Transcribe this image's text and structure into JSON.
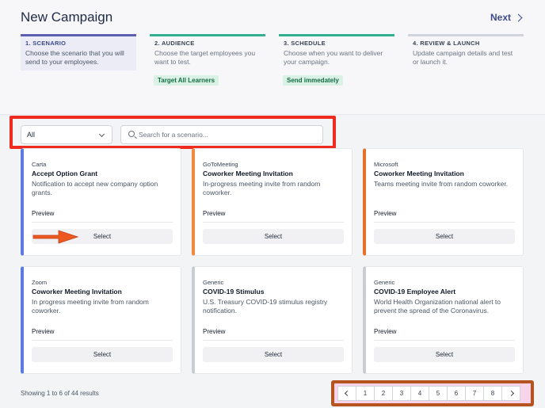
{
  "header": {
    "title": "New Campaign",
    "next_label": "Next"
  },
  "steps": [
    {
      "title": "1. SCENARIO",
      "desc": "Choose the scenario that you will send to your employees."
    },
    {
      "title": "2. AUDIENCE",
      "desc": "Choose the target employees you want to test.",
      "badge": "Target All Learners"
    },
    {
      "title": "3. SCHEDULE",
      "desc": "Choose when you want to deliver your campaign.",
      "badge": "Send immedately"
    },
    {
      "title": "4. REVIEW & LAUNCH",
      "desc": "Update campaign details and test or launch it."
    }
  ],
  "filter": {
    "selected": "All",
    "search_placeholder": "Search for a scenario..."
  },
  "cards": [
    {
      "vendor": "Carta",
      "name": "Accept Option Grant",
      "desc": "Notification to accept new company option grants.",
      "preview": "Preview",
      "select": "Select",
      "accent": "#5b7be0"
    },
    {
      "vendor": "GoToMeeting",
      "name": "Coworker Meeting Invitation",
      "desc": "In-progress meeting invite from random coworker.",
      "preview": "Preview",
      "select": "Select",
      "accent": "#f08a3c"
    },
    {
      "vendor": "Microsoft",
      "name": "Coworker Meeting Invitation",
      "desc": "Teams meeting invite from random coworker.",
      "preview": "Preview",
      "select": "Select",
      "accent": "#e8702a"
    },
    {
      "vendor": "Zoom",
      "name": "Coworker Meeting Invitation",
      "desc": "In progress meeting invite from random coworker.",
      "preview": "Preview",
      "select": "Select",
      "accent": "#5b7be0"
    },
    {
      "vendor": "Generic",
      "name": "COVID-19 Stimulus",
      "desc": "U.S. Treasury COVID-19 stimulus registry notification.",
      "preview": "Preview",
      "select": "Select",
      "accent": "#c9ccd2"
    },
    {
      "vendor": "Generic",
      "name": "COVID-19 Employee Alert",
      "desc": "World Health Organization national alert to prevent the spread of the Coronavirus.",
      "preview": "Preview",
      "select": "Select",
      "accent": "#c9ccd2"
    }
  ],
  "footer": {
    "results_text": "Showing 1 to 6 of 44 results",
    "pages": [
      "1",
      "2",
      "3",
      "4",
      "5",
      "6",
      "7",
      "8"
    ]
  },
  "colors": {
    "primary": "#3d4a8a",
    "highlight_red": "#ee2b1e",
    "highlight_brown": "#b5541e",
    "green": "#33b08d"
  }
}
